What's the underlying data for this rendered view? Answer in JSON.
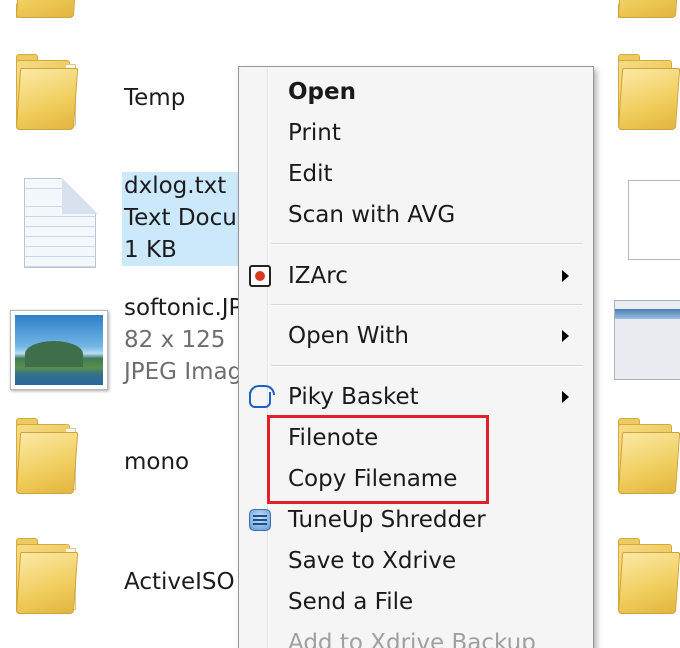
{
  "explorer": {
    "files": [
      {
        "name": "Temp",
        "type": "folder"
      },
      {
        "name": "dxlog.txt",
        "detail": "Text Docu",
        "size": "1 KB",
        "type": "text",
        "selected": true
      },
      {
        "name": "softonic.JP",
        "detail": "82 x 125",
        "type_label": "JPEG Imag",
        "type": "image"
      },
      {
        "name": "mono",
        "type": "folder"
      },
      {
        "name": "ActiveISO",
        "type": "folder"
      }
    ]
  },
  "context_menu": {
    "items": [
      {
        "label": "Open",
        "bold": true
      },
      {
        "label": "Print"
      },
      {
        "label": "Edit"
      },
      {
        "label": "Scan with AVG"
      },
      {
        "label": "IZArc",
        "icon": "izarc-icon",
        "submenu": true
      },
      {
        "label": "Open With",
        "submenu": true
      },
      {
        "label": "Piky Basket",
        "icon": "basket-icon",
        "submenu": true
      },
      {
        "label": "Filenote"
      },
      {
        "label": "Copy Filename"
      },
      {
        "label": "TuneUp Shredder",
        "icon": "tuneup-shredder-icon"
      },
      {
        "label": "Save to Xdrive"
      },
      {
        "label": "Send a File"
      },
      {
        "label": "Add to Xdrive Backup",
        "disabled": true
      }
    ]
  },
  "colors": {
    "selection": "#cce8fb",
    "highlight_box": "#e2202a",
    "menu_background": "#f5f5f5"
  }
}
